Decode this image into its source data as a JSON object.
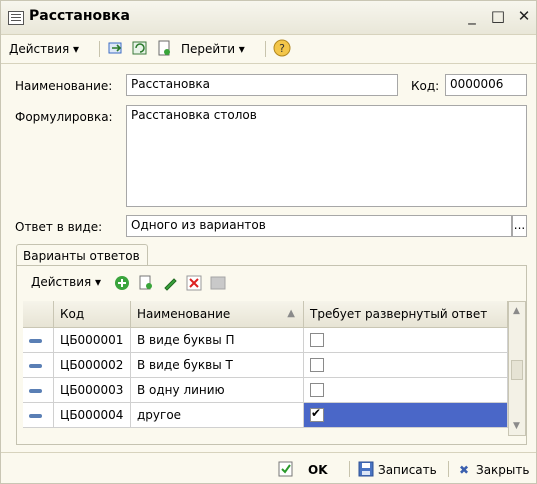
{
  "window": {
    "title": "Расстановка",
    "buttons": {
      "minimize": "_",
      "maximize": "□",
      "close": "✕"
    }
  },
  "toolbar": {
    "actions_label": "Действия ▾",
    "goto_label": "Перейти ▾",
    "help": "?"
  },
  "form": {
    "name_label": "Наименование:",
    "name_value": "Расстановка",
    "code_label": "Код:",
    "code_value": "0000006",
    "formulation_label": "Формулировка:",
    "formulation_value": "Расстановка столов",
    "answer_label": "Ответ в виде:",
    "answer_value": "Одного из вариантов",
    "answer_button": "..."
  },
  "tab": {
    "label": "Варианты ответов",
    "actions_label": "Действия ▾"
  },
  "table": {
    "columns": [
      "Код",
      "Наименование",
      "Требует развернутый ответ"
    ],
    "rows": [
      {
        "code": "ЦБ000001",
        "name": "В виде буквы П",
        "checked": false
      },
      {
        "code": "ЦБ000002",
        "name": "В виде буквы Т",
        "checked": false
      },
      {
        "code": "ЦБ000003",
        "name": "В одну линию",
        "checked": false
      },
      {
        "code": "ЦБ000004",
        "name": "другое",
        "checked": true
      }
    ]
  },
  "footer": {
    "ok": "OK",
    "save": "Записать",
    "close": "Закрыть"
  }
}
